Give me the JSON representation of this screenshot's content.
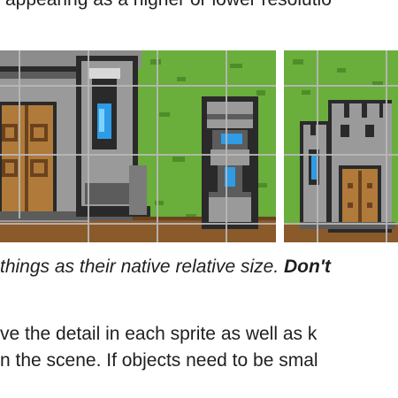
{
  "document": {
    "top_line": "appearing as a higher or lower resolutio",
    "caption_italic": "things as their native relative size. ",
    "caption_bold": "Don't",
    "body_line_1": "ve the detail in each sprite as well as k",
    "body_line_2": "n the scene. If objects need to be smal"
  },
  "palette": {
    "grass": "#6aae3c",
    "grass_dark": "#4f8d2a",
    "dirt": "#8a5a2b",
    "wood": "#b07a3a",
    "stone": "#9a9a9a",
    "stone_dark": "#5c5c5c",
    "outline": "#2a2a2a",
    "water_blue": "#2e9be6",
    "grid": "#b9b9b9"
  }
}
